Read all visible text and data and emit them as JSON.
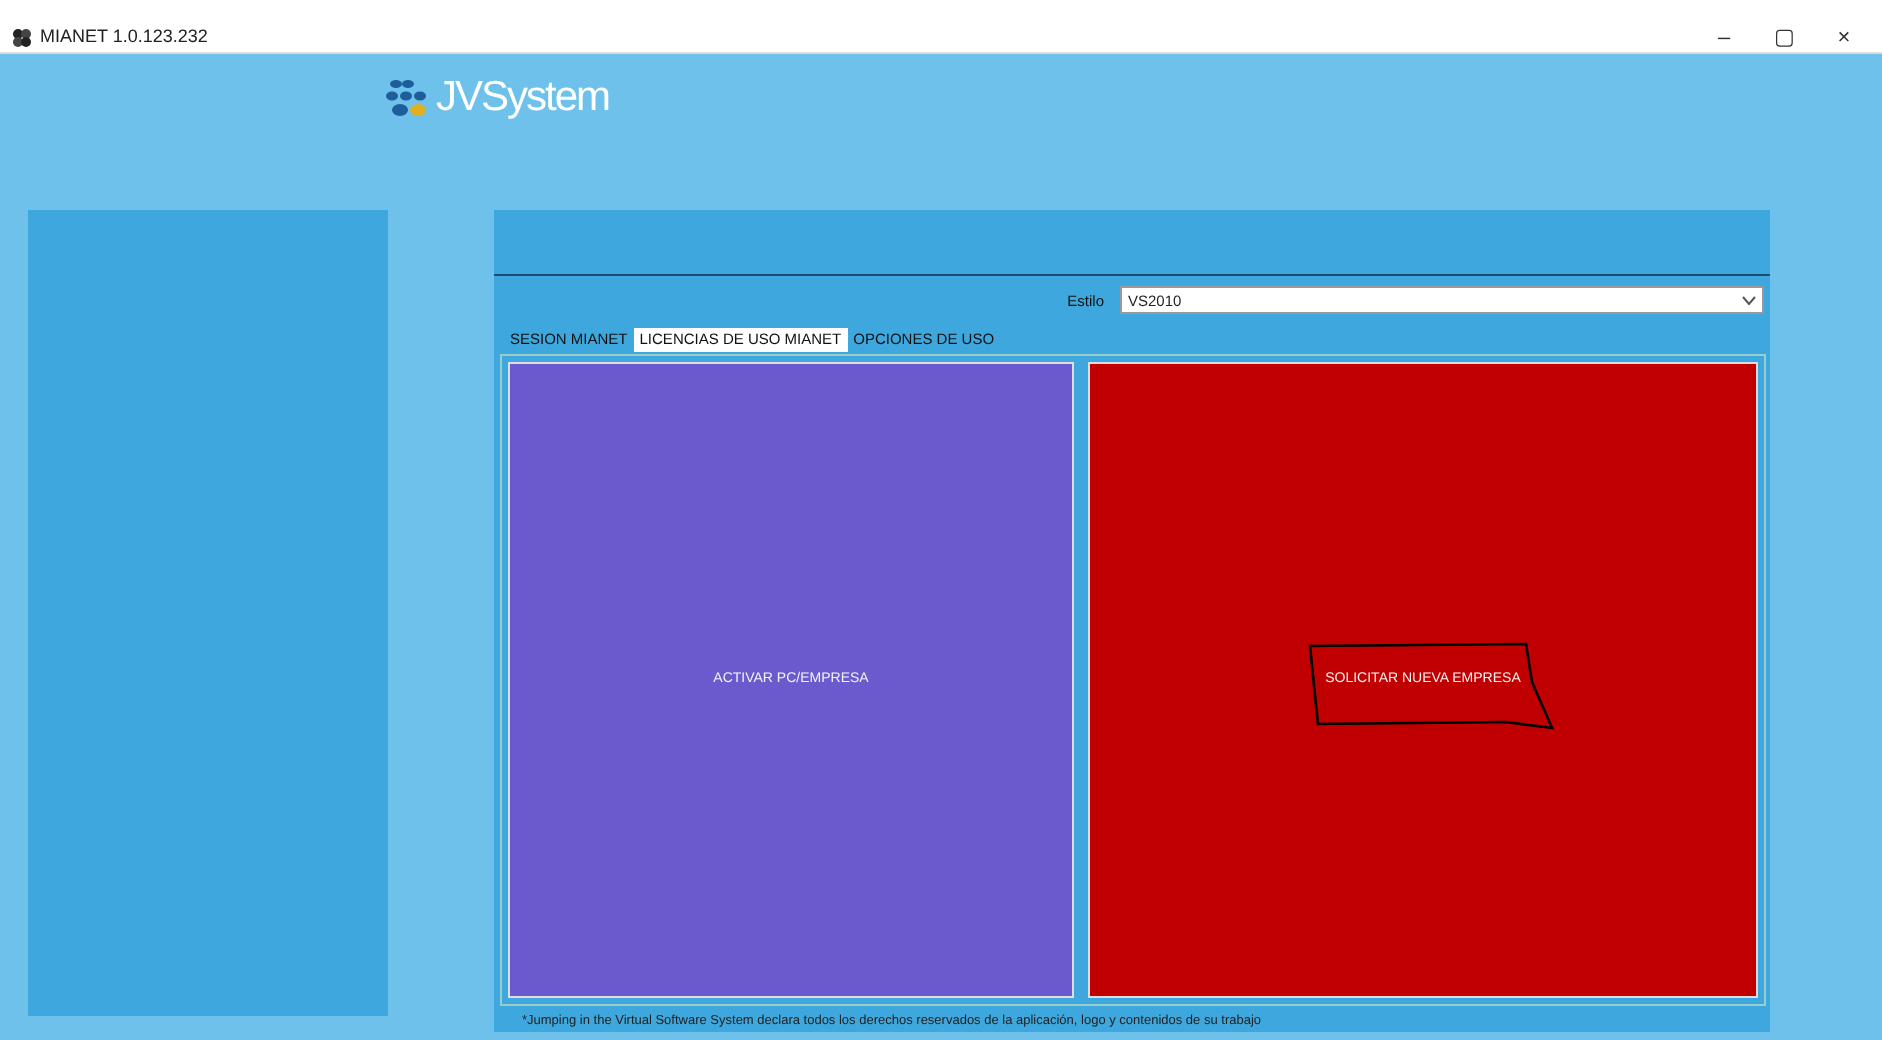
{
  "window": {
    "title": "MIANET 1.0.123.232",
    "controls": [
      "–",
      "▢",
      "×"
    ]
  },
  "logo": {
    "text": "JVSystem"
  },
  "style_field": {
    "label": "Estilo",
    "value": "VS2010"
  },
  "tabs": [
    {
      "label": "SESION MIANET",
      "selected": false
    },
    {
      "label": "LICENCIAS DE USO MIANET",
      "selected": true
    },
    {
      "label": "OPCIONES DE USO",
      "selected": false
    }
  ],
  "actions": [
    {
      "label": "ACTIVAR PC/EMPRESA",
      "color": "#6b5acd",
      "outlined": false
    },
    {
      "label": "SOLICITAR NUEVA EMPRESA",
      "color": "#c00000",
      "outlined": true
    }
  ],
  "footer": "*Jumping in the Virtual Software System declara todos los derechos reservados de la aplicación, logo y contenidos de su trabajo"
}
